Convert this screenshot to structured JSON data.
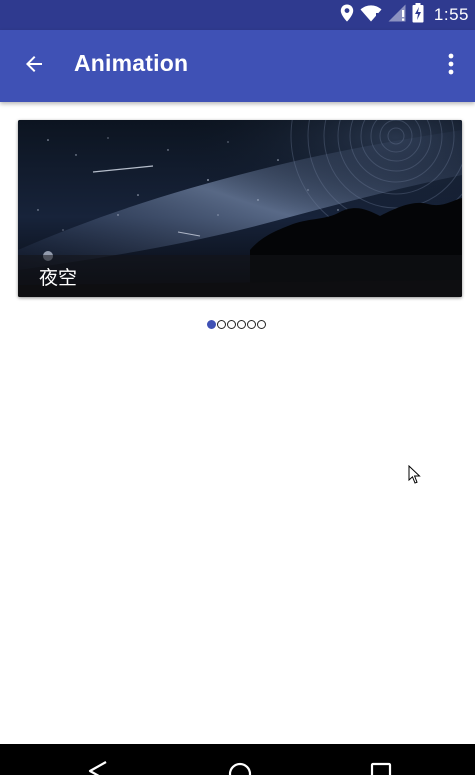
{
  "status_bar": {
    "time": "1:55",
    "icons": [
      "location-icon",
      "wifi-icon",
      "cellular-signal-icon",
      "battery-charging-icon"
    ],
    "background_color": "#2f3a8f"
  },
  "app_bar": {
    "title": "Animation",
    "back_icon": "arrow-back-icon",
    "overflow_icon": "more-vert-icon",
    "background_color": "#3f51b5"
  },
  "banner": {
    "image": "night-sky-milky-way-photo",
    "caption": "夜空",
    "page_count": 6,
    "current_page": 1
  },
  "nav_bar": {
    "buttons": [
      "back-triangle-icon",
      "home-circle-icon",
      "recents-square-icon"
    ]
  }
}
